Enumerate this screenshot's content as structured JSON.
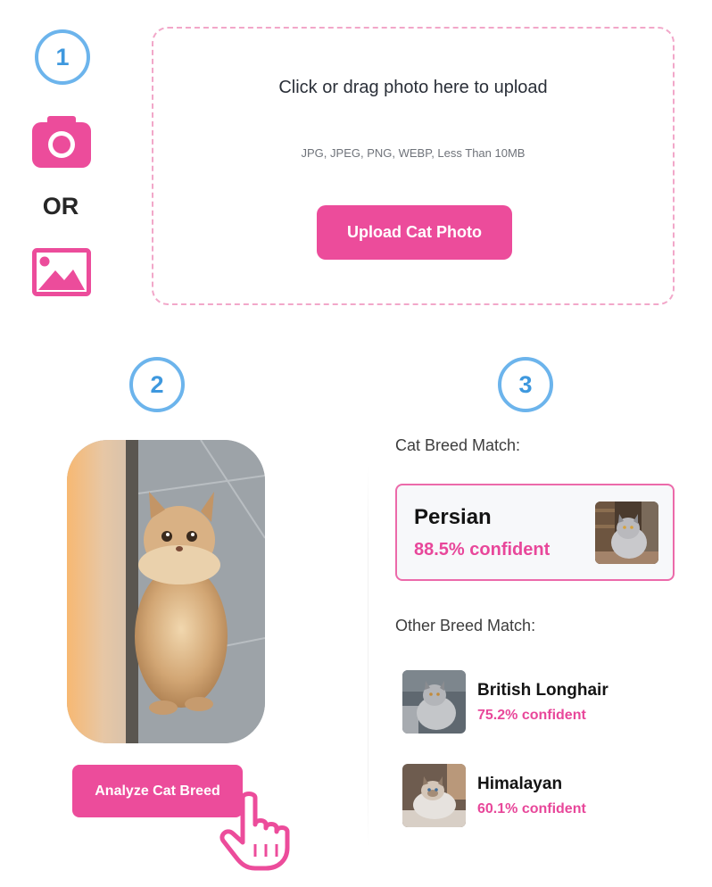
{
  "steps": [
    "1",
    "2",
    "3"
  ],
  "upload": {
    "camera_icon": "camera-icon",
    "gallery_icon": "image-icon",
    "or_label": "OR",
    "title": "Click or drag photo here to upload",
    "hint": "JPG, JPEG, PNG, WEBP, Less Than 10MB",
    "button_label": "Upload Cat Photo"
  },
  "analyze": {
    "button_label": "Analyze Cat Breed",
    "pointer_icon": "hand-pointer-icon"
  },
  "results": {
    "match_label": "Cat Breed Match:",
    "top_match": {
      "name": "Persian",
      "confidence": "88.5% confident"
    },
    "other_label": "Other Breed Match:",
    "others": [
      {
        "name": "British Longhair",
        "confidence": "75.2% confident"
      },
      {
        "name": "Himalayan",
        "confidence": "60.1% confident"
      }
    ]
  },
  "colors": {
    "accent_pink": "#ec4c9b",
    "step_blue": "#6cb4ec",
    "dashed_border": "#f2a7c9"
  }
}
